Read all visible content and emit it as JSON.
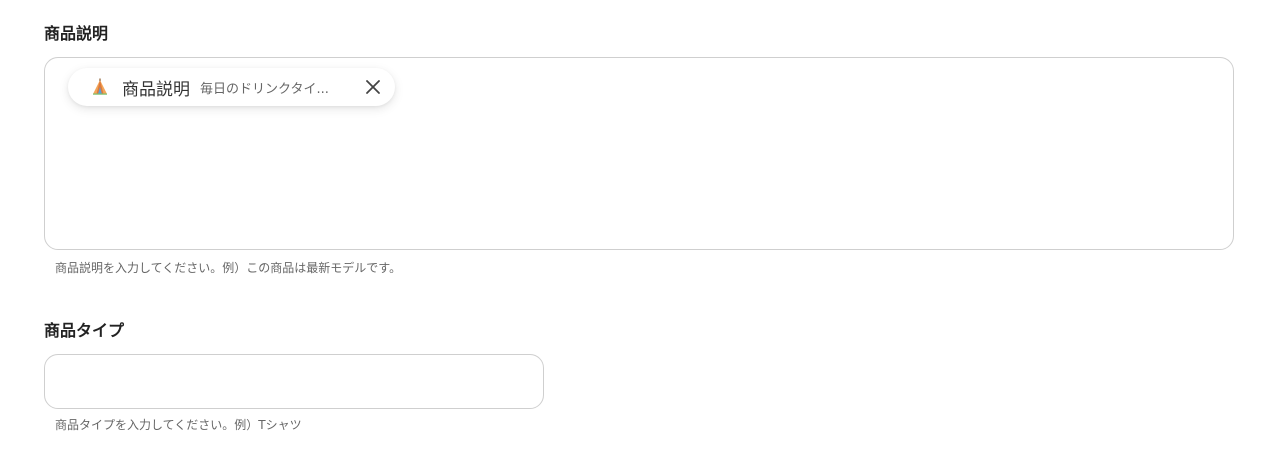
{
  "fields": {
    "description": {
      "label": "商品説明",
      "chip": {
        "icon": "tent-icon",
        "name": "商品説明",
        "value": "毎日のドリンクタイ..."
      },
      "helper": "商品説明を入力してください。例）この商品は最新モデルです。"
    },
    "type": {
      "label": "商品タイプ",
      "value": "",
      "helper": "商品タイプを入力してください。例）Tシャツ"
    }
  }
}
